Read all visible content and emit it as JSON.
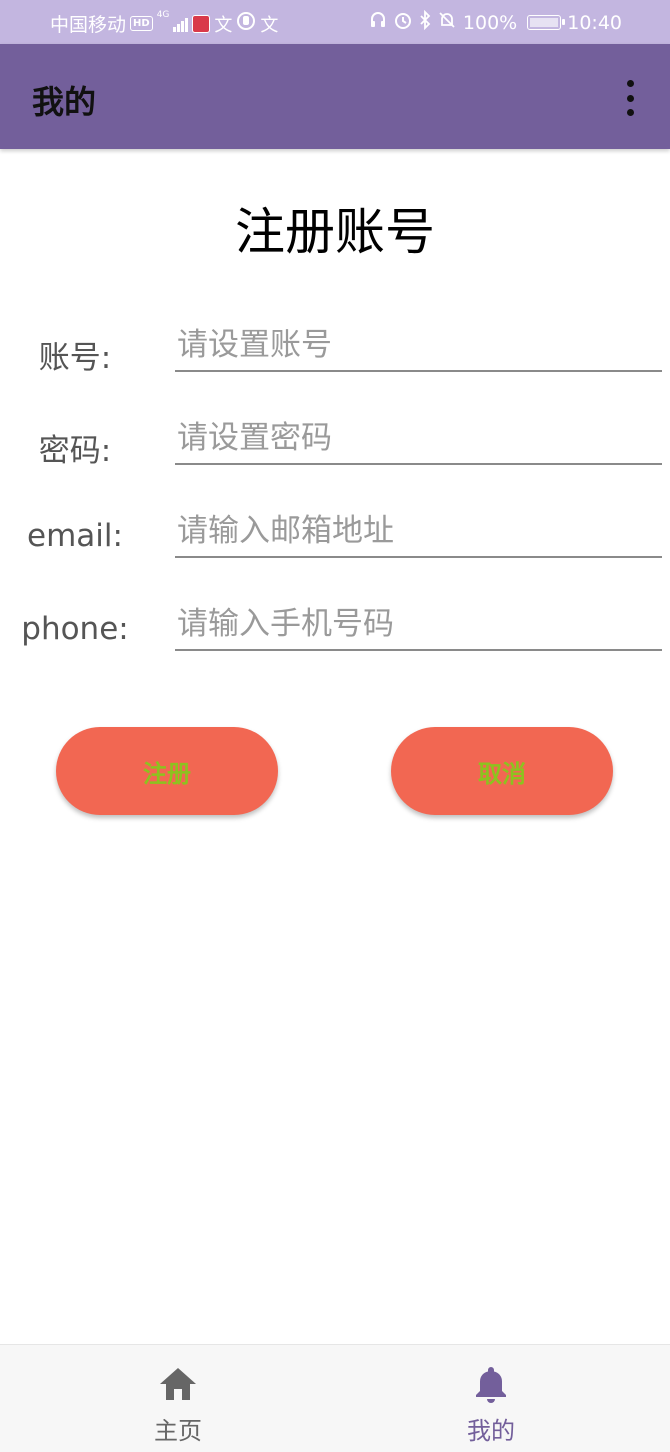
{
  "status_bar": {
    "carrier": "中国移动",
    "hd_badge": "HD",
    "network": "4G",
    "lang_glyph_1": "文",
    "lang_glyph_2": "文",
    "battery_percent": "100%",
    "time": "10:40",
    "battery_level": 1.0
  },
  "app_bar": {
    "title": "我的",
    "overflow_icon": "more-vert-icon"
  },
  "form": {
    "heading": "注册账号",
    "fields": [
      {
        "label": "账号:",
        "placeholder": "请设置账号",
        "value": ""
      },
      {
        "label": "密码:",
        "placeholder": "请设置密码",
        "value": ""
      },
      {
        "label": "email:",
        "placeholder": "请输入邮箱地址",
        "value": ""
      },
      {
        "label": "phone:",
        "placeholder": "请输入手机号码",
        "value": ""
      }
    ],
    "register_label": "注册",
    "cancel_label": "取消"
  },
  "bottom_nav": {
    "items": [
      {
        "label": "主页",
        "icon": "home-icon",
        "active": false
      },
      {
        "label": "我的",
        "icon": "bell-icon",
        "active": true
      }
    ]
  },
  "colors": {
    "status_bar": "#c3b6e0",
    "app_bar": "#735f9b",
    "button_bg": "#f26752",
    "button_text": "#8dc21f",
    "nav_active": "#735f9b",
    "nav_inactive": "#666666"
  }
}
